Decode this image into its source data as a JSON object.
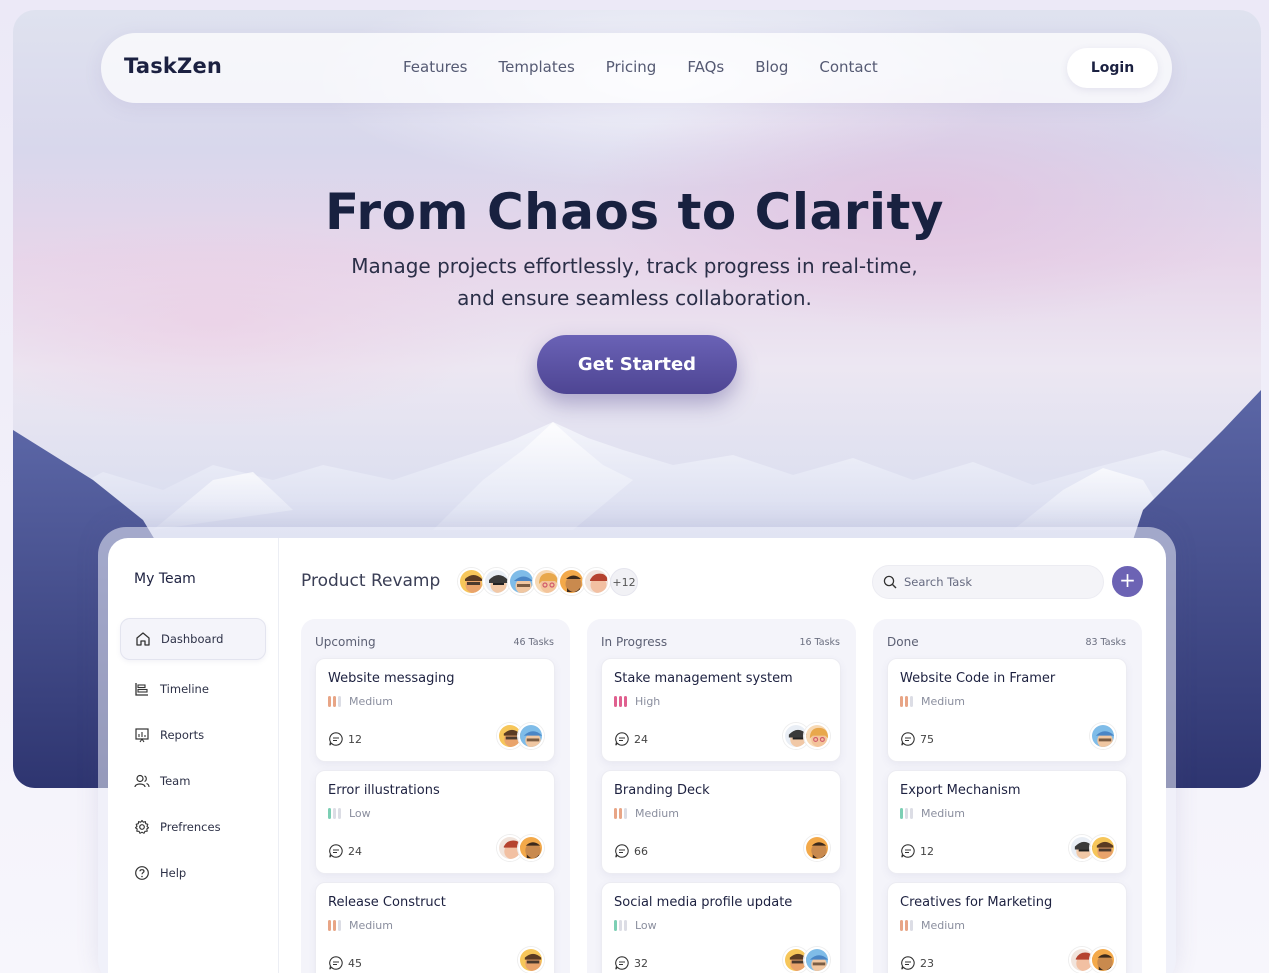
{
  "brand": "TaskZen",
  "nav": {
    "links": [
      "Features",
      "Templates",
      "Pricing",
      "FAQs",
      "Blog",
      "Contact"
    ],
    "login": "Login"
  },
  "hero": {
    "title": "From Chaos to Clarity",
    "subtitle_line1": "Manage projects effortlessly, track progress in real-time,",
    "subtitle_line2": "and ensure seamless collaboration.",
    "cta": "Get Started"
  },
  "app": {
    "sidebar": {
      "title": "My Team",
      "items": [
        "Dashboard",
        "Timeline",
        "Reports",
        "Team",
        "Prefrences",
        "Help"
      ],
      "active": "Dashboard"
    },
    "project_title": "Product Revamp",
    "member_more": "+12",
    "search_placeholder": "Search Task",
    "add_label": "+",
    "columns": [
      {
        "name": "Upcoming",
        "count": "46 Tasks",
        "cards": [
          {
            "title": "Website messaging",
            "priority": "Medium",
            "comments": "12"
          },
          {
            "title": "Error illustrations",
            "priority": "Low",
            "comments": "24"
          },
          {
            "title": "Release Construct",
            "priority": "Medium",
            "comments": "45"
          }
        ]
      },
      {
        "name": "In Progress",
        "count": "16 Tasks",
        "cards": [
          {
            "title": "Stake management system",
            "priority": "High",
            "comments": "24"
          },
          {
            "title": "Branding Deck",
            "priority": "Medium",
            "comments": "66"
          },
          {
            "title": "Social media profile update",
            "priority": "Low",
            "comments": "32"
          }
        ]
      },
      {
        "name": "Done",
        "count": "83 Tasks",
        "cards": [
          {
            "title": "Website Code in Framer",
            "priority": "Medium",
            "comments": "75"
          },
          {
            "title": "Export Mechanism",
            "priority": "Medium",
            "comments": "12"
          },
          {
            "title": "Creatives for Marketing",
            "priority": "Medium",
            "comments": "23"
          }
        ]
      }
    ]
  },
  "colors": {
    "accent": "#6c63b4",
    "cta_top": "#6a62b6",
    "cta_bottom": "#4e4593",
    "priority_medium": "#e8a586",
    "priority_high": "#e0608f",
    "priority_low": "#7ccfb4",
    "priority_off": "#dcdde5"
  }
}
